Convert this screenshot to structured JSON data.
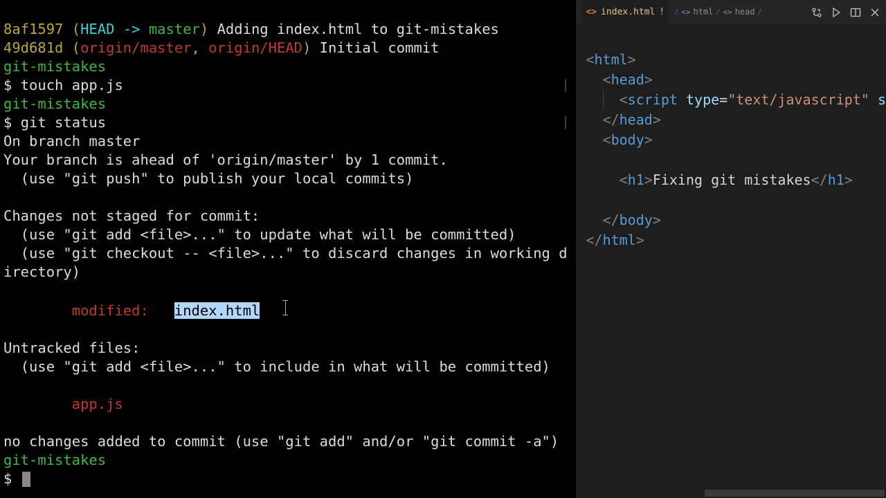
{
  "terminal": {
    "log1_hash": "8af1597",
    "log1_refs_open": " (",
    "log1_head": "HEAD -> ",
    "log1_branch": "master",
    "log1_refs_close": ")",
    "log1_msg": " Adding index.html to git-mistakes",
    "log2_hash": "49d681d",
    "log2_refs_open": " (",
    "log2_origin_master": "origin/master",
    "log2_sep": ", ",
    "log2_origin_head": "origin/HEAD",
    "log2_refs_close": ")",
    "log2_msg": " Initial commit",
    "dir": "git-mistakes",
    "prompt": "$ ",
    "cmd1": "touch app.js",
    "cmd2": "git status",
    "status1": "On branch master",
    "status2": "Your branch is ahead of 'origin/master' by 1 commit.",
    "status3": "  (use \"git push\" to publish your local commits)",
    "status4": "Changes not staged for commit:",
    "status5": "  (use \"git add <file>...\" to update what will be committed)",
    "status6": "  (use \"git checkout -- <file>...\" to discard changes in working directory)",
    "modified_label": "        modified:   ",
    "modified_file": "index.html",
    "untracked_header": "Untracked files:",
    "untracked_hint": "  (use \"git add <file>...\" to include in what will be committed)",
    "untracked_file": "        app.js",
    "summary": "no changes added to commit (use \"git add\" and/or \"git commit -a\")"
  },
  "editor": {
    "tab": {
      "filename": "index.html",
      "dirty": "!"
    },
    "breadcrumbs": {
      "b1": "html",
      "b2": "head"
    },
    "code": {
      "l1_tag": "html",
      "l2_tag": "head",
      "l3_tag": "script",
      "l3_attr": "type",
      "l3_val": "\"text/javascript\"",
      "l3_trail": " s",
      "l4_tag": "head",
      "l5_tag": "body",
      "l6_tag": "h1",
      "l6_text": "Fixing git mistakes",
      "l7_tag": "body",
      "l8_tag": "html"
    }
  }
}
